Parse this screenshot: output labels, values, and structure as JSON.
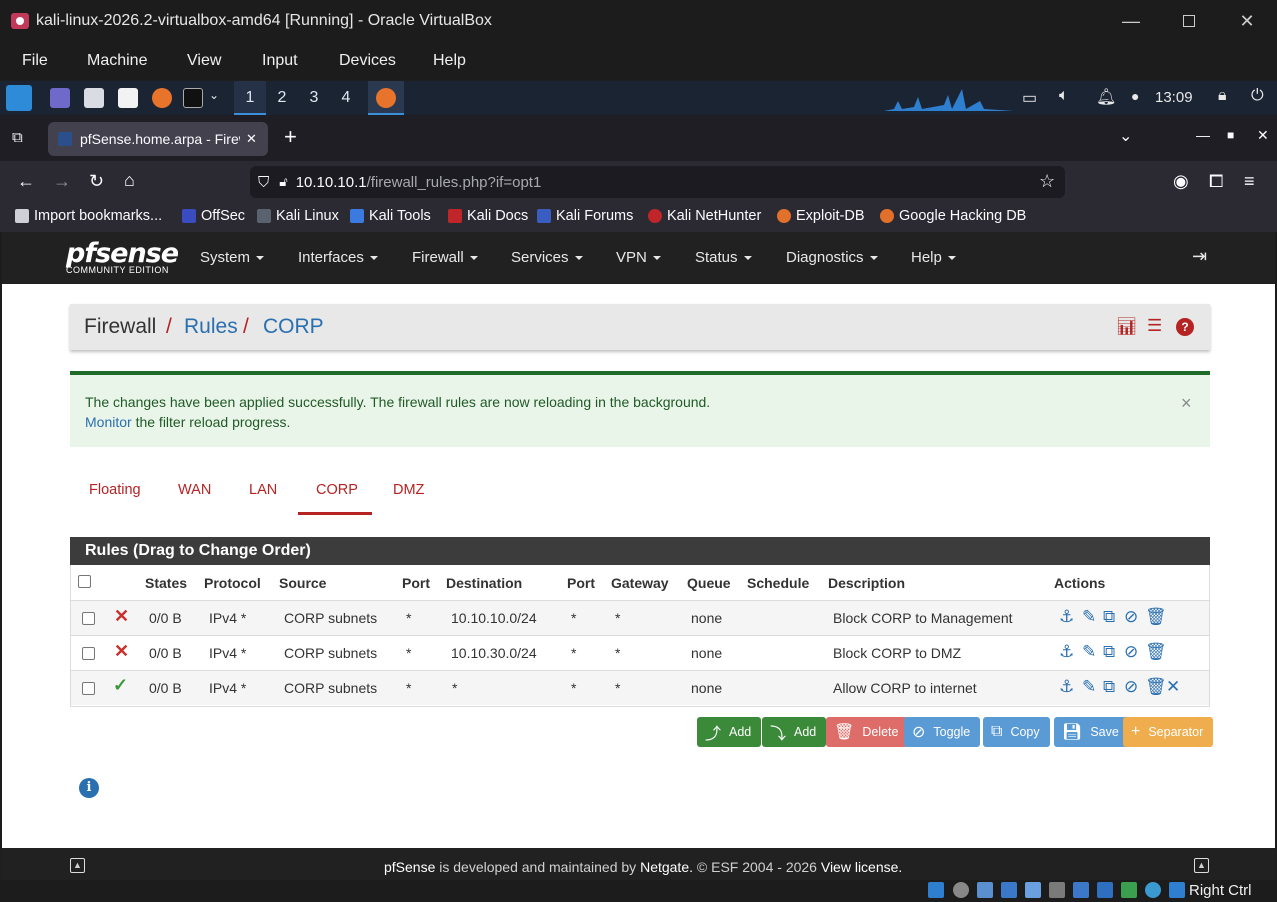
{
  "vbox": {
    "title": "kali-linux-2026.2-virtualbox-amd64 [Running] - Oracle VirtualBox",
    "menu": [
      "File",
      "Machine",
      "View",
      "Input",
      "Devices",
      "Help"
    ],
    "status_host_key": "Right Ctrl"
  },
  "panel": {
    "workspaces": [
      "1",
      "2",
      "3",
      "4"
    ],
    "clock": "13:09"
  },
  "browser": {
    "tab_title": "pfSense.home.arpa - Firew",
    "url_host": "10.10.10.1",
    "url_path": "/firewall_rules.php?if=opt1",
    "bookmarks": [
      "Import bookmarks...",
      "OffSec",
      "Kali Linux",
      "Kali Tools",
      "Kali Docs",
      "Kali Forums",
      "Kali NetHunter",
      "Exploit-DB",
      "Google Hacking DB"
    ]
  },
  "pfsense": {
    "logo_main": "pfsense",
    "logo_sub": "COMMUNITY EDITION",
    "nav": [
      "System",
      "Interfaces",
      "Firewall",
      "Services",
      "VPN",
      "Status",
      "Diagnostics",
      "Help"
    ],
    "breadcrumb": {
      "root": "Firewall",
      "sep": "/",
      "level2": "Rules",
      "level3": "CORP"
    },
    "alert": {
      "line1": "The changes have been applied successfully. The firewall rules are now reloading in the background.",
      "link": "Monitor",
      "line2_rest": " the filter reload progress.",
      "close": "×"
    },
    "tabs": [
      "Floating",
      "WAN",
      "LAN",
      "CORP",
      "DMZ"
    ],
    "active_tab": "CORP",
    "panel_title": "Rules (Drag to Change Order)",
    "columns": [
      "States",
      "Protocol",
      "Source",
      "Port",
      "Destination",
      "Port",
      "Gateway",
      "Queue",
      "Schedule",
      "Description",
      "Actions"
    ],
    "rules": [
      {
        "action": "block",
        "states": "0/0 B",
        "protocol": "IPv4 *",
        "source": "CORP subnets",
        "sport": "*",
        "destination": "10.10.10.0/24",
        "dport": "*",
        "gateway": "*",
        "queue": "none",
        "schedule": "",
        "description": "Block CORP to Management"
      },
      {
        "action": "block",
        "states": "0/0 B",
        "protocol": "IPv4 *",
        "source": "CORP subnets",
        "sport": "*",
        "destination": "10.10.30.0/24",
        "dport": "*",
        "gateway": "*",
        "queue": "none",
        "schedule": "",
        "description": "Block CORP to DMZ"
      },
      {
        "action": "pass",
        "states": "0/0 B",
        "protocol": "IPv4 *",
        "source": "CORP subnets",
        "sport": "*",
        "destination": "*",
        "dport": "*",
        "gateway": "*",
        "queue": "none",
        "schedule": "",
        "description": "Allow CORP to internet"
      }
    ],
    "buttons": [
      "Add",
      "Add",
      "Delete",
      "Toggle",
      "Copy",
      "Save",
      "Separator"
    ],
    "footer": {
      "brand": "pfSense",
      "text1": " is developed and maintained by ",
      "company": "Netgate.",
      "text2": " © ESF 2004 - 2026 ",
      "license": "View license."
    }
  },
  "colors": {
    "block": "#c9302c",
    "pass": "#3a9a3a",
    "tab_active": "#b52323",
    "link": "#2a6fb0"
  }
}
